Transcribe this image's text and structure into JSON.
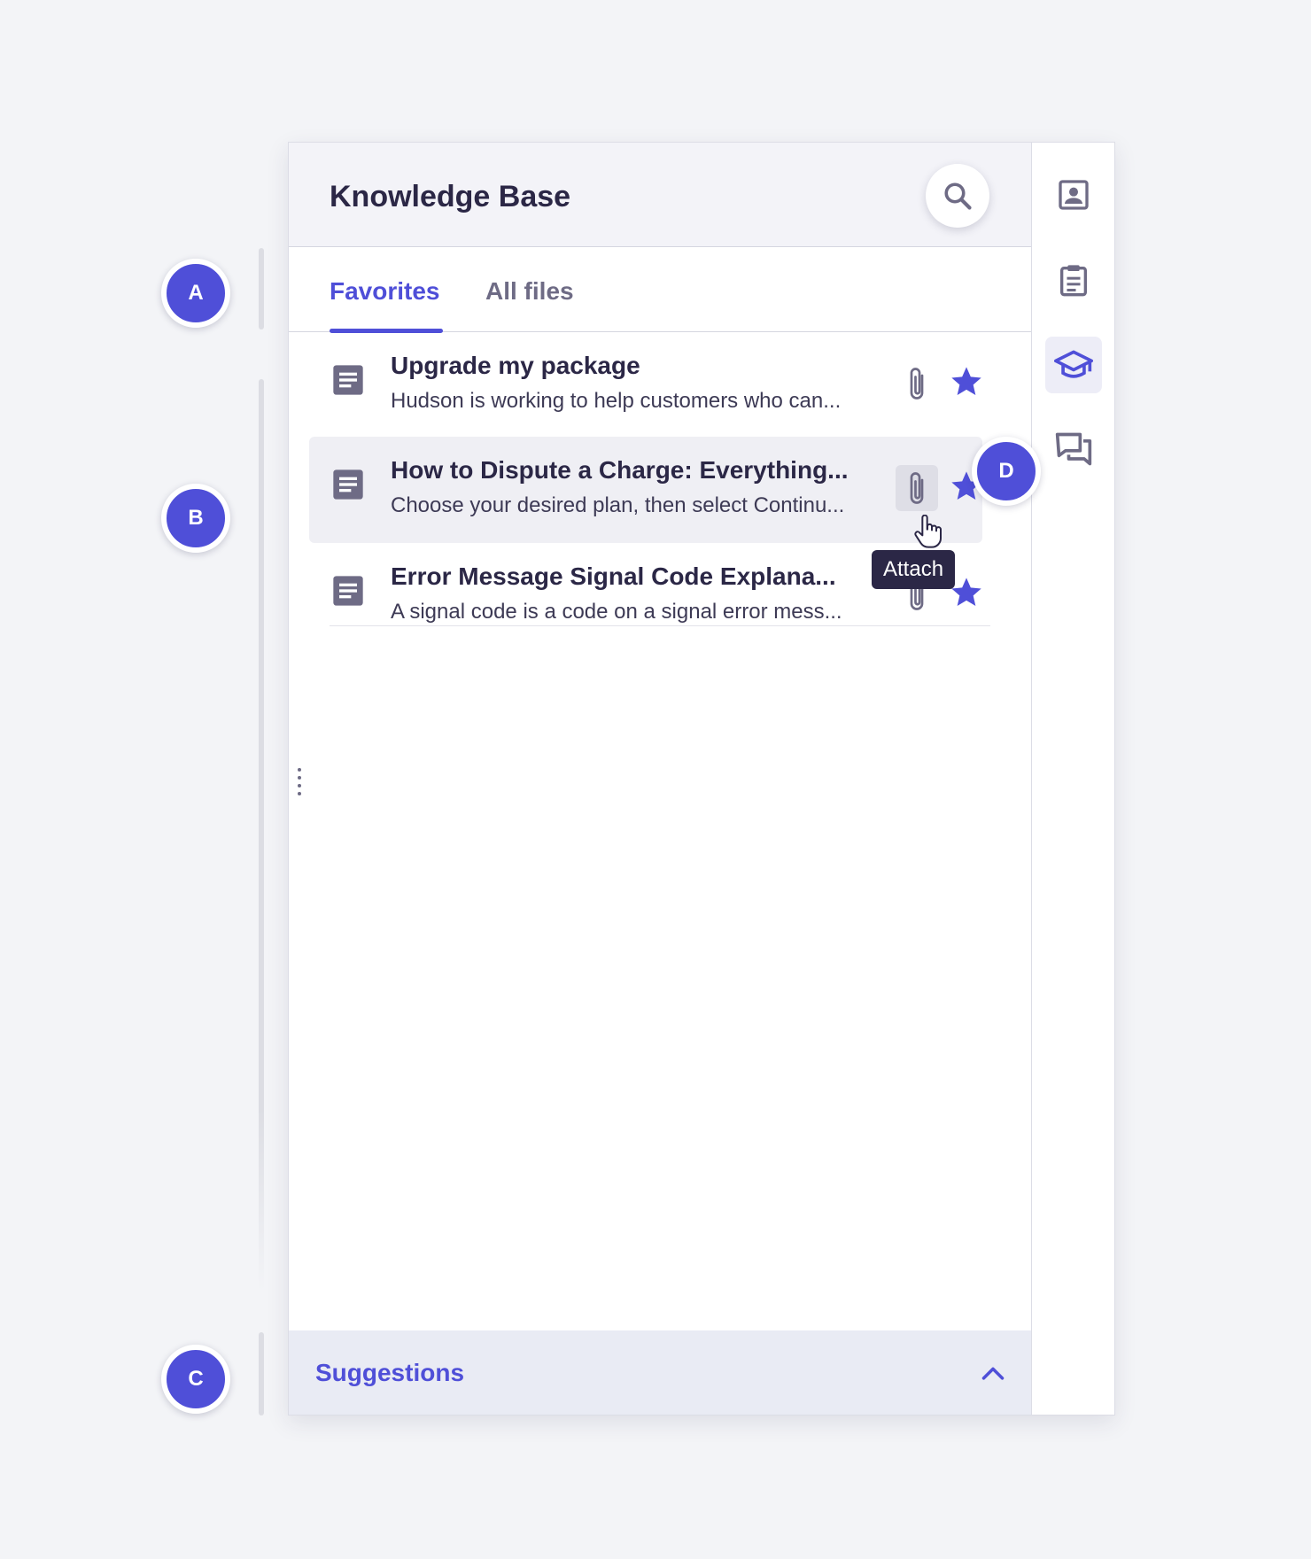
{
  "header": {
    "title": "Knowledge Base"
  },
  "tabs": {
    "favorites": "Favorites",
    "all_files": "All files"
  },
  "articles": [
    {
      "title": "Upgrade my package",
      "description": "Hudson is working to help customers who can..."
    },
    {
      "title": "How to Dispute a Charge: Everything...",
      "description": "Choose your desired plan, then select Continu..."
    },
    {
      "title": "Error Message Signal Code Explana...",
      "description": "A signal code is a code on a signal error mess..."
    }
  ],
  "tooltip": "Attach",
  "suggestions": {
    "label": "Suggestions"
  },
  "annotations": {
    "a": "A",
    "b": "B",
    "c": "C",
    "d": "D"
  },
  "colors": {
    "accent": "#4f4fd8",
    "dark": "#2b2746",
    "muted": "#6e6b85"
  },
  "icons": [
    "search-icon",
    "document-icon",
    "paperclip-icon",
    "star-icon",
    "chevron-up-icon",
    "contact-icon",
    "clipboard-icon",
    "graduation-cap-icon",
    "chat-icon"
  ]
}
